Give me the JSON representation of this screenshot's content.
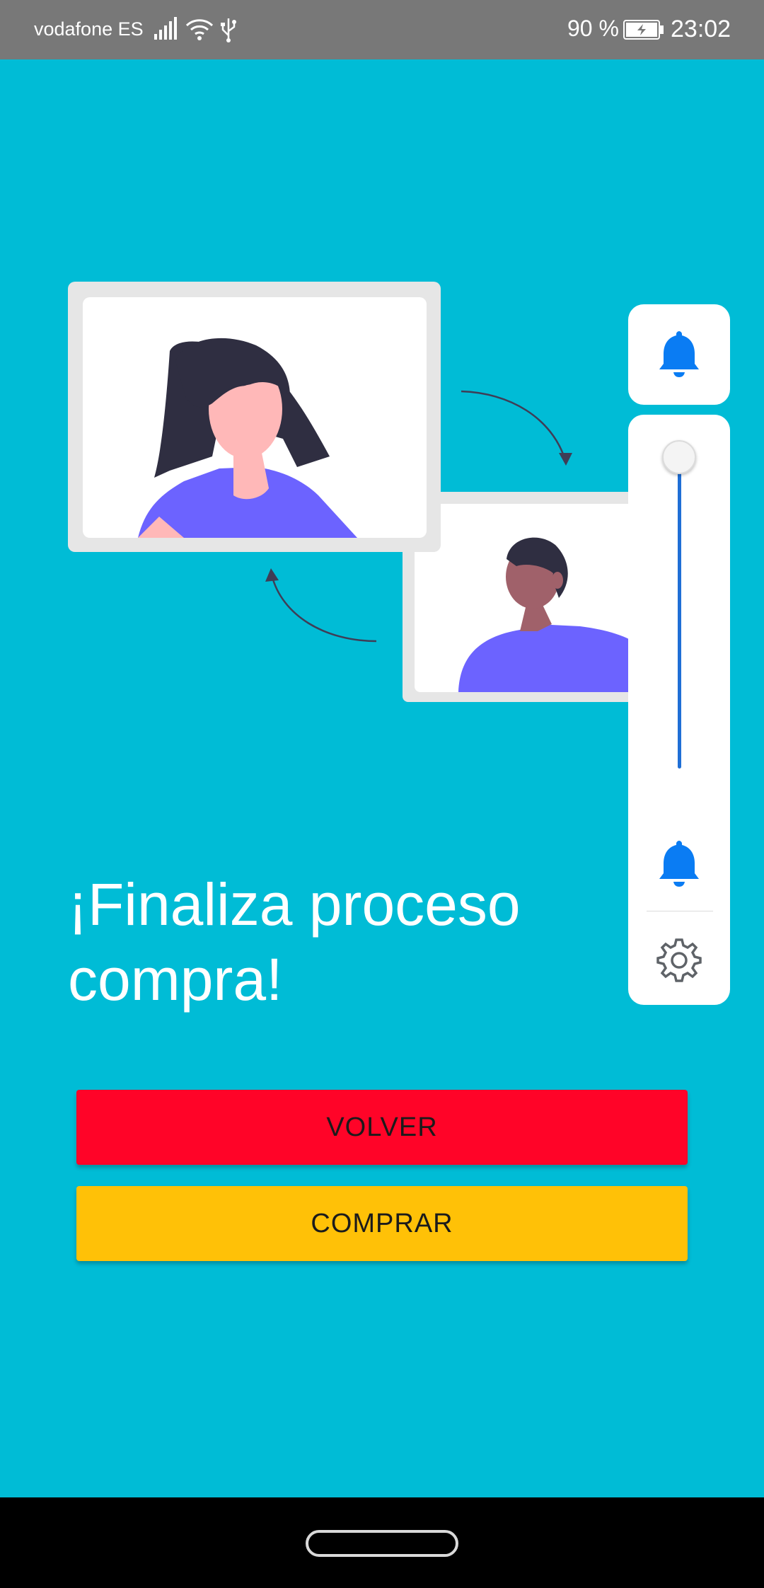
{
  "status_bar": {
    "carrier": "vodafone ES",
    "battery_percent": "90 %",
    "time": "23:02",
    "icons": [
      "signal-icon",
      "wifi-icon",
      "usb-icon",
      "battery-charging-icon"
    ]
  },
  "illustration": {
    "name": "video-call-illustration"
  },
  "headline": "¡Finaliza proceso compra!",
  "buttons": {
    "volver": "VOLVER",
    "comprar": "COMPRAR"
  },
  "volume_panel": {
    "level_percent": 100,
    "icons": [
      "bell-icon",
      "bell-icon",
      "gear-icon"
    ],
    "accent_color": "#0A7CF3"
  },
  "colors": {
    "background": "#00BCD6",
    "volver": "#FF0428",
    "comprar": "#FFC107",
    "status_bar": "#787878"
  }
}
